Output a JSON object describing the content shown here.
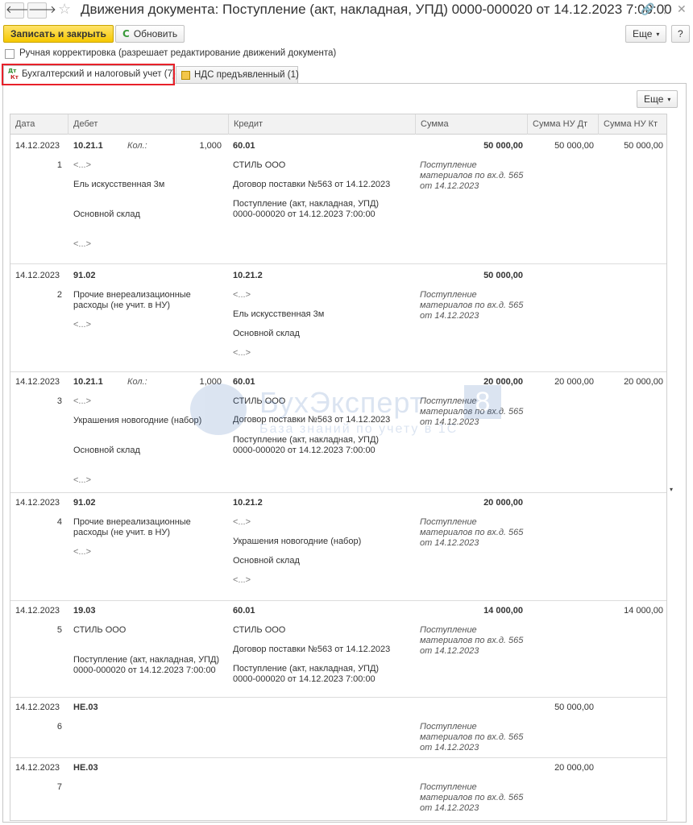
{
  "window": {
    "title": "Движения документа: Поступление (акт, накладная, УПД) 0000-000020 от 14.12.2023 7:00:00",
    "back_glyph": "🡐",
    "forward_glyph": "🡒",
    "star_glyph": "☆",
    "link_glyph": "🔗",
    "menu_glyph": "⋮",
    "close_glyph": "✕"
  },
  "toolbar": {
    "save_close_label": "Записать и закрыть",
    "refresh_label": "Обновить",
    "refresh_glyph": "C",
    "more_label": "Еще",
    "help_label": "?",
    "caret_glyph": "▾"
  },
  "manual": {
    "label": "Ручная корректировка (разрешает редактирование движений документа)"
  },
  "tabs": [
    {
      "label": "Бухгалтерский и налоговый учет (7)",
      "icon": "dt-kt-icon",
      "icon_dt": "Дт",
      "icon_kt": "Кт",
      "active": true
    },
    {
      "label": "НДС предъявленный (1)",
      "icon": "vat-icon",
      "active": false
    }
  ],
  "table": {
    "more_label": "Еще",
    "columns": [
      "Дата",
      "Дебет",
      "Кредит",
      "Сумма",
      "Сумма НУ Дт",
      "Сумма НУ Кт"
    ],
    "scroll_glyph": "▾",
    "rows": [
      {
        "date": "14.12.2023",
        "num": "1",
        "debit": [
          "10.21.1",
          "<...>",
          "Ель искусственная 3м",
          "Основной склад",
          "<...>"
        ],
        "qty_label": "Кол.:",
        "qty": "1,000",
        "credit": [
          "60.01",
          "СТИЛЬ ООО",
          "Договор поставки №563 от 14.12.2023",
          "Поступление (акт, накладная, УПД)",
          "0000-000020 от 14.12.2023 7:00:00"
        ],
        "sum": "50 000,00",
        "content": [
          "Поступление",
          "материалов по вх.д. 565",
          "от 14.12.2023"
        ],
        "nu_dt": "50 000,00",
        "nu_kt": "50 000,00"
      },
      {
        "date": "14.12.2023",
        "num": "2",
        "debit": [
          "91.02",
          "Прочие внереализационные",
          "расходы (не учит. в НУ)",
          "<...>"
        ],
        "credit": [
          "10.21.2",
          "<...>",
          "Ель искусственная 3м",
          "Основной склад",
          "<...>"
        ],
        "sum": "50 000,00",
        "content": [
          "Поступление",
          "материалов по вх.д. 565",
          "от 14.12.2023"
        ],
        "nu_dt": "",
        "nu_kt": ""
      },
      {
        "date": "14.12.2023",
        "num": "3",
        "debit": [
          "10.21.1",
          "<...>",
          "Украшения новогодние (набор)",
          "Основной склад",
          "<...>"
        ],
        "qty_label": "Кол.:",
        "qty": "1,000",
        "credit": [
          "60.01",
          "СТИЛЬ ООО",
          "Договор поставки №563 от 14.12.2023",
          "Поступление (акт, накладная, УПД)",
          "0000-000020 от 14.12.2023 7:00:00"
        ],
        "sum": "20 000,00",
        "content": [
          "Поступление",
          "материалов по вх.д. 565",
          "от 14.12.2023"
        ],
        "nu_dt": "20 000,00",
        "nu_kt": "20 000,00"
      },
      {
        "date": "14.12.2023",
        "num": "4",
        "debit": [
          "91.02",
          "Прочие внереализационные",
          "расходы (не учит. в НУ)",
          "<...>"
        ],
        "credit": [
          "10.21.2",
          "<...>",
          "Украшения новогодние (набор)",
          "Основной склад",
          "<...>"
        ],
        "sum": "20 000,00",
        "content": [
          "Поступление",
          "материалов по вх.д. 565",
          "от 14.12.2023"
        ],
        "nu_dt": "",
        "nu_kt": ""
      },
      {
        "date": "14.12.2023",
        "num": "5",
        "debit": [
          "19.03",
          "СТИЛЬ ООО",
          "Поступление (акт, накладная, УПД)",
          "0000-000020 от 14.12.2023 7:00:00"
        ],
        "credit": [
          "60.01",
          "СТИЛЬ ООО",
          "Договор поставки №563 от 14.12.2023",
          "Поступление (акт, накладная, УПД)",
          "0000-000020 от 14.12.2023 7:00:00"
        ],
        "sum": "14 000,00",
        "content": [
          "Поступление",
          "материалов по вх.д. 565",
          "от 14.12.2023"
        ],
        "nu_dt": "",
        "nu_kt": "14 000,00"
      },
      {
        "date": "14.12.2023",
        "num": "6",
        "debit": [
          "НЕ.03"
        ],
        "credit": [],
        "sum": "",
        "content": [
          "Поступление",
          "материалов по вх.д. 565",
          "от 14.12.2023"
        ],
        "nu_dt": "50 000,00",
        "nu_kt": ""
      },
      {
        "date": "14.12.2023",
        "num": "7",
        "debit": [
          "НЕ.03"
        ],
        "credit": [],
        "sum": "",
        "content": [
          "Поступление",
          "материалов по вх.д. 565",
          "от 14.12.2023"
        ],
        "nu_dt": "20 000,00",
        "nu_kt": ""
      }
    ]
  },
  "watermark": {
    "text": "БухЭксперт",
    "badge": "8",
    "sub": "База знаний по учету в 1С"
  }
}
